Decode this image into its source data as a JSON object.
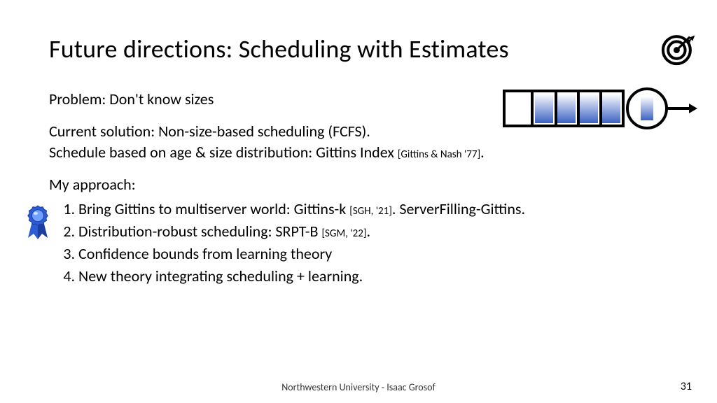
{
  "title": "Future directions: Scheduling with Estimates",
  "problem_line": "Problem: Don't know sizes",
  "current_solution_line1": "Current solution: Non-size-based scheduling (FCFS).",
  "current_solution_line2_pre": "Schedule based on age & size distribution: Gittins Index ",
  "current_solution_cite": "[Gittins & Nash '77]",
  "current_solution_line2_post": ".",
  "approach_label": "My approach:",
  "items": {
    "i1_pre": "Bring Gittins to multiserver world: Gittins-k ",
    "i1_cite": "[SGH, '21]",
    "i1_post": ". ServerFilling-Gittins.",
    "i2_pre": "Distribution-robust scheduling: SRPT-B ",
    "i2_cite": "[SGM, '22]",
    "i2_post": ".",
    "i3": "Confidence bounds from learning theory",
    "i4": "New theory integrating scheduling + learning."
  },
  "footer_center": "Northwestern University - Isaac Grosof",
  "page_number": "31",
  "icons": {
    "target": "target-icon",
    "award_ribbon": "award-ribbon-icon",
    "queue": "queue-server-diagram"
  },
  "colors": {
    "ribbon_blue": "#2a5cd6",
    "ribbon_dark": "#1c3ea0",
    "job_grad_top": "#ffffff",
    "job_grad_bottom": "#3b62c4"
  }
}
